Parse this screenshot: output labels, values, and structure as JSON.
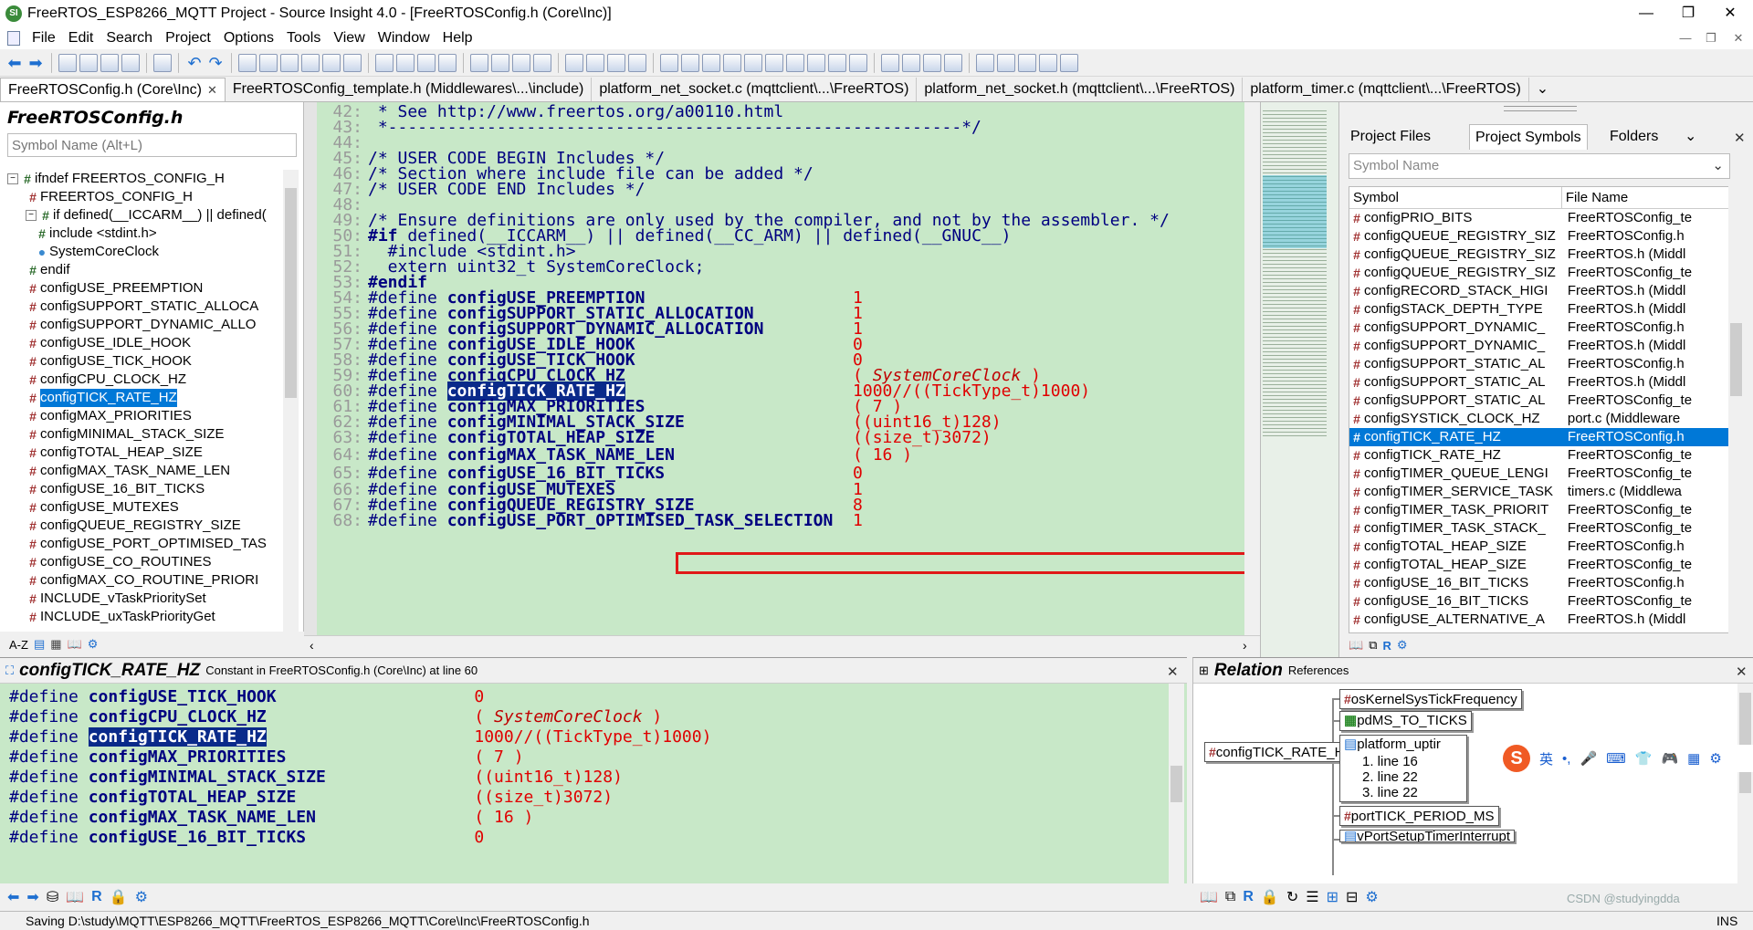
{
  "window": {
    "title": "FreeRTOS_ESP8266_MQTT Project - Source Insight 4.0 - [FreeRTOSConfig.h (Core\\Inc)]",
    "min": "—",
    "max": "❐",
    "close": "✕"
  },
  "menu": [
    "File",
    "Edit",
    "Search",
    "Project",
    "Options",
    "Tools",
    "View",
    "Window",
    "Help"
  ],
  "menu_right": {
    "min": "—",
    "restore": "❐",
    "close": "✕"
  },
  "tabs": [
    {
      "label": "FreeRTOSConfig.h (Core\\Inc)",
      "close": "✕"
    },
    {
      "label": "FreeRTOSConfig_template.h (Middlewares\\...\\include)"
    },
    {
      "label": "platform_net_socket.c (mqttclient\\...\\FreeRTOS)"
    },
    {
      "label": "platform_net_socket.h (mqttclient\\...\\FreeRTOS)"
    },
    {
      "label": "platform_timer.c (mqttclient\\...\\FreeRTOS)"
    }
  ],
  "tabs_more": "⌄",
  "left_panel": {
    "title": "FreeRTOSConfig.h",
    "search_placeholder": "Symbol Name (Alt+L)",
    "items": [
      {
        "label": "ifndef FREERTOS_CONFIG_H",
        "icon": "hash"
      },
      {
        "label": "FREERTOS_CONFIG_H",
        "icon": "hash"
      },
      {
        "label": "if defined(__ICCARM__) || defined(",
        "icon": "hash"
      },
      {
        "label": "include <stdint.h>",
        "icon": "include"
      },
      {
        "label": "SystemCoreClock",
        "icon": "variable"
      },
      {
        "label": "endif",
        "icon": "hash"
      },
      {
        "label": "configUSE_PREEMPTION",
        "icon": "hash"
      },
      {
        "label": "configSUPPORT_STATIC_ALLOCA",
        "icon": "hash"
      },
      {
        "label": "configSUPPORT_DYNAMIC_ALLO",
        "icon": "hash"
      },
      {
        "label": "configUSE_IDLE_HOOK",
        "icon": "hash"
      },
      {
        "label": "configUSE_TICK_HOOK",
        "icon": "hash"
      },
      {
        "label": "configCPU_CLOCK_HZ",
        "icon": "hash"
      },
      {
        "label": "configTICK_RATE_HZ",
        "icon": "hash",
        "selected": true
      },
      {
        "label": "configMAX_PRIORITIES",
        "icon": "hash"
      },
      {
        "label": "configMINIMAL_STACK_SIZE",
        "icon": "hash"
      },
      {
        "label": "configTOTAL_HEAP_SIZE",
        "icon": "hash"
      },
      {
        "label": "configMAX_TASK_NAME_LEN",
        "icon": "hash"
      },
      {
        "label": "configUSE_16_BIT_TICKS",
        "icon": "hash"
      },
      {
        "label": "configUSE_MUTEXES",
        "icon": "hash"
      },
      {
        "label": "configQUEUE_REGISTRY_SIZE",
        "icon": "hash"
      },
      {
        "label": "configUSE_PORT_OPTIMISED_TAS",
        "icon": "hash"
      },
      {
        "label": "configUSE_CO_ROUTINES",
        "icon": "hash"
      },
      {
        "label": "configMAX_CO_ROUTINE_PRIORI",
        "icon": "hash"
      },
      {
        "label": "INCLUDE_vTaskPrioritySet",
        "icon": "hash"
      },
      {
        "label": "INCLUDE_uxTaskPriorityGet",
        "icon": "hash"
      }
    ],
    "footer": [
      "A-Z",
      "list",
      "tree",
      "book",
      "gear"
    ]
  },
  "editor": {
    "lines": [
      {
        "n": "42:",
        "parts": [
          {
            "t": " * See http://www.freertos.org/a00110.html",
            "c": "cm"
          }
        ]
      },
      {
        "n": "43:",
        "parts": [
          {
            "t": " *----------------------------------------------------------*/",
            "c": "cm"
          }
        ]
      },
      {
        "n": "44:",
        "parts": []
      },
      {
        "n": "45:",
        "parts": [
          {
            "t": "/* USER CODE BEGIN Includes */",
            "c": "cm"
          }
        ]
      },
      {
        "n": "46:",
        "parts": [
          {
            "t": "/* Section where include file can be added */",
            "c": "cm"
          }
        ]
      },
      {
        "n": "47:",
        "parts": [
          {
            "t": "/* USER CODE END Includes */",
            "c": "cm"
          }
        ]
      },
      {
        "n": "48:",
        "parts": []
      },
      {
        "n": "49:",
        "parts": [
          {
            "t": "/* Ensure definitions are only used by the compiler, and not by the assembler. */",
            "c": "cm"
          }
        ]
      },
      {
        "n": "50:",
        "parts": [
          {
            "t": "#if ",
            "c": "kw"
          },
          {
            "t": "defined",
            "c": "cm"
          },
          {
            "t": "(__ICCARM__) || ",
            "c": "cm"
          },
          {
            "t": "defined",
            "c": "cm"
          },
          {
            "t": "(__CC_ARM) || ",
            "c": "cm"
          },
          {
            "t": "defined",
            "c": "cm"
          },
          {
            "t": "(__GNUC__)",
            "c": "cm"
          }
        ]
      },
      {
        "n": "51:",
        "parts": [
          {
            "t": "  #include <stdint.h>",
            "c": "cm"
          }
        ]
      },
      {
        "n": "52:",
        "parts": [
          {
            "t": "  extern uint32_t ",
            "c": "cm"
          },
          {
            "t": "SystemCoreClock",
            "c": "cm"
          },
          {
            "t": ";",
            "c": "cm"
          }
        ]
      },
      {
        "n": "53:",
        "parts": [
          {
            "t": "#endif",
            "c": "kw"
          }
        ]
      },
      {
        "n": "54:",
        "parts": [
          {
            "t": "#define ",
            "c": "cm"
          },
          {
            "t": "configUSE_PREEMPTION",
            "c": "mac"
          },
          {
            "t": "                     1",
            "c": "num"
          }
        ]
      },
      {
        "n": "55:",
        "parts": [
          {
            "t": "#define ",
            "c": "cm"
          },
          {
            "t": "configSUPPORT_STATIC_ALLOCATION",
            "c": "mac"
          },
          {
            "t": "          1",
            "c": "num"
          }
        ]
      },
      {
        "n": "56:",
        "parts": [
          {
            "t": "#define ",
            "c": "cm"
          },
          {
            "t": "configSUPPORT_DYNAMIC_ALLOCATION",
            "c": "mac"
          },
          {
            "t": "         1",
            "c": "num"
          }
        ]
      },
      {
        "n": "57:",
        "parts": [
          {
            "t": "#define ",
            "c": "cm"
          },
          {
            "t": "configUSE_IDLE_HOOK",
            "c": "mac"
          },
          {
            "t": "                      0",
            "c": "num"
          }
        ]
      },
      {
        "n": "58:",
        "parts": [
          {
            "t": "#define ",
            "c": "cm"
          },
          {
            "t": "configUSE_TICK_HOOK",
            "c": "mac"
          },
          {
            "t": "                      0",
            "c": "num"
          }
        ]
      },
      {
        "n": "59:",
        "parts": [
          {
            "t": "#define ",
            "c": "cm"
          },
          {
            "t": "configCPU_CLOCK_HZ",
            "c": "mac"
          },
          {
            "t": "                       ( ",
            "c": "num"
          },
          {
            "t": "SystemCoreClock",
            "c": "it"
          },
          {
            "t": " )",
            "c": "num"
          }
        ]
      },
      {
        "n": "60:",
        "parts": [
          {
            "t": "#define ",
            "c": "cm"
          },
          {
            "t": "configTICK_RATE_HZ",
            "c": "sel"
          },
          {
            "t": "                       1000//((TickType_t)1000)",
            "c": "num"
          }
        ]
      },
      {
        "n": "61:",
        "parts": [
          {
            "t": "#define ",
            "c": "cm"
          },
          {
            "t": "configMAX_PRIORITIES",
            "c": "mac"
          },
          {
            "t": "                     ( 7 )",
            "c": "num"
          }
        ]
      },
      {
        "n": "62:",
        "parts": [
          {
            "t": "#define ",
            "c": "cm"
          },
          {
            "t": "configMINIMAL_STACK_SIZE",
            "c": "mac"
          },
          {
            "t": "                 ((uint16_t)128)",
            "c": "num"
          }
        ]
      },
      {
        "n": "63:",
        "parts": [
          {
            "t": "#define ",
            "c": "cm"
          },
          {
            "t": "configTOTAL_HEAP_SIZE",
            "c": "mac"
          },
          {
            "t": "                    ((size_t)3072)",
            "c": "num"
          }
        ]
      },
      {
        "n": "64:",
        "parts": [
          {
            "t": "#define ",
            "c": "cm"
          },
          {
            "t": "configMAX_TASK_NAME_LEN",
            "c": "mac"
          },
          {
            "t": "                  ( 16 )",
            "c": "num"
          }
        ]
      },
      {
        "n": "65:",
        "parts": [
          {
            "t": "#define ",
            "c": "cm"
          },
          {
            "t": "configUSE_16_BIT_TICKS",
            "c": "mac"
          },
          {
            "t": "                   0",
            "c": "num"
          }
        ]
      },
      {
        "n": "66:",
        "parts": [
          {
            "t": "#define ",
            "c": "cm"
          },
          {
            "t": "configUSE_MUTEXES",
            "c": "mac"
          },
          {
            "t": "                        1",
            "c": "num"
          }
        ]
      },
      {
        "n": "67:",
        "parts": [
          {
            "t": "#define ",
            "c": "cm"
          },
          {
            "t": "configQUEUE_REGISTRY_SIZE",
            "c": "mac"
          },
          {
            "t": "                8",
            "c": "num"
          }
        ]
      },
      {
        "n": "68:",
        "parts": [
          {
            "t": "#define ",
            "c": "cm"
          },
          {
            "t": "configUSE_PORT_OPTIMISED_TASK_SELECTION",
            "c": "mac"
          },
          {
            "t": "  1",
            "c": "num"
          }
        ]
      }
    ]
  },
  "right_panel": {
    "tabs": [
      "Project Files",
      "Project Symbols",
      "Folders"
    ],
    "tab_more": "⌄",
    "close": "✕",
    "search_placeholder": "Symbol Name",
    "columns": [
      "Symbol",
      "File Name"
    ],
    "rows": [
      [
        "configPRIO_BITS",
        "FreeRTOSConfig_te"
      ],
      [
        "configQUEUE_REGISTRY_SIZ",
        "FreeRTOSConfig.h"
      ],
      [
        "configQUEUE_REGISTRY_SIZ",
        "FreeRTOS.h (Middl"
      ],
      [
        "configQUEUE_REGISTRY_SIZ",
        "FreeRTOSConfig_te"
      ],
      [
        "configRECORD_STACK_HIGI",
        "FreeRTOS.h (Middl"
      ],
      [
        "configSTACK_DEPTH_TYPE",
        "FreeRTOS.h (Middl"
      ],
      [
        "configSUPPORT_DYNAMIC_",
        "FreeRTOSConfig.h"
      ],
      [
        "configSUPPORT_DYNAMIC_",
        "FreeRTOS.h (Middl"
      ],
      [
        "configSUPPORT_STATIC_AL",
        "FreeRTOSConfig.h"
      ],
      [
        "configSUPPORT_STATIC_AL",
        "FreeRTOS.h (Middl"
      ],
      [
        "configSUPPORT_STATIC_AL",
        "FreeRTOSConfig_te"
      ],
      [
        "configSYSTICK_CLOCK_HZ",
        "port.c (Middleware"
      ],
      [
        "configTICK_RATE_HZ",
        "FreeRTOSConfig.h"
      ],
      [
        "configTICK_RATE_HZ",
        "FreeRTOSConfig_te"
      ],
      [
        "configTIMER_QUEUE_LENGI",
        "FreeRTOSConfig_te"
      ],
      [
        "configTIMER_SERVICE_TASK",
        "timers.c (Middlewa"
      ],
      [
        "configTIMER_TASK_PRIORIT",
        "FreeRTOSConfig_te"
      ],
      [
        "configTIMER_TASK_STACK_",
        "FreeRTOSConfig_te"
      ],
      [
        "configTOTAL_HEAP_SIZE",
        "FreeRTOSConfig.h"
      ],
      [
        "configTOTAL_HEAP_SIZE",
        "FreeRTOSConfig_te"
      ],
      [
        "configUSE_16_BIT_TICKS",
        "FreeRTOSConfig.h"
      ],
      [
        "configUSE_16_BIT_TICKS",
        "FreeRTOSConfig_te"
      ],
      [
        "configUSE_ALTERNATIVE_A",
        "FreeRTOS.h (Middl"
      ]
    ],
    "selected_row": 12
  },
  "context": {
    "title": "configTICK_RATE_HZ",
    "subtitle": "Constant in FreeRTOSConfig.h (Core\\Inc) at line 60",
    "close": "✕",
    "lines": [
      {
        "parts": [
          {
            "t": "#define ",
            "c": "cm"
          },
          {
            "t": "configUSE_TICK_HOOK",
            "c": "mac"
          },
          {
            "t": "                    0",
            "c": "num"
          }
        ]
      },
      {
        "parts": [
          {
            "t": "#define ",
            "c": "cm"
          },
          {
            "t": "configCPU_CLOCK_HZ",
            "c": "mac"
          },
          {
            "t": "                     ( ",
            "c": "num"
          },
          {
            "t": "SystemCoreClock",
            "c": "it"
          },
          {
            "t": " )",
            "c": "num"
          }
        ]
      },
      {
        "parts": [
          {
            "t": "#define ",
            "c": "cm"
          },
          {
            "t": "configTICK_RATE_HZ",
            "c": "sel"
          },
          {
            "t": "                     1000//((TickType_t)1000)",
            "c": "num"
          }
        ]
      },
      {
        "parts": [
          {
            "t": "#define ",
            "c": "cm"
          },
          {
            "t": "configMAX_PRIORITIES",
            "c": "mac"
          },
          {
            "t": "                   ( 7 )",
            "c": "num"
          }
        ]
      },
      {
        "parts": [
          {
            "t": "#define ",
            "c": "cm"
          },
          {
            "t": "configMINIMAL_STACK_SIZE",
            "c": "mac"
          },
          {
            "t": "               ((uint16_t)128)",
            "c": "num"
          }
        ]
      },
      {
        "parts": [
          {
            "t": "#define ",
            "c": "cm"
          },
          {
            "t": "configTOTAL_HEAP_SIZE",
            "c": "mac"
          },
          {
            "t": "                  ((size_t)3072)",
            "c": "num"
          }
        ]
      },
      {
        "parts": [
          {
            "t": "#define ",
            "c": "cm"
          },
          {
            "t": "configMAX_TASK_NAME_LEN",
            "c": "mac"
          },
          {
            "t": "                ( 16 )",
            "c": "num"
          }
        ]
      },
      {
        "parts": [
          {
            "t": "#define ",
            "c": "cm"
          },
          {
            "t": "configUSE_16_BIT_TICKS",
            "c": "mac"
          },
          {
            "t": "                 0",
            "c": "num"
          }
        ]
      }
    ]
  },
  "relation": {
    "title": "Relation",
    "subtitle": "References",
    "close": "✕",
    "root": "configTICK_RATE_HZ",
    "nodes": [
      "osKernelSysTickFrequency",
      "pdMS_TO_TICKS",
      "platform_uptir",
      "portTICK_PERIOD_MS",
      "vPortSetupTimerInterrupt"
    ],
    "sub_items": [
      "1. line 16",
      "2. line 22",
      "3. line 22"
    ]
  },
  "ime": {
    "lang": "英",
    "items": [
      "•,",
      "🎤",
      "⌨",
      "👕",
      "🎮",
      "▦",
      "⚙"
    ]
  },
  "status": {
    "text": "Saving D:\\study\\MQTT\\ESP8266_MQTT\\FreeRTOS_ESP8266_MQTT\\Core\\Inc\\FreeRTOSConfig.h",
    "mode": "INS",
    "watermark": "CSDN @studyingdda"
  }
}
